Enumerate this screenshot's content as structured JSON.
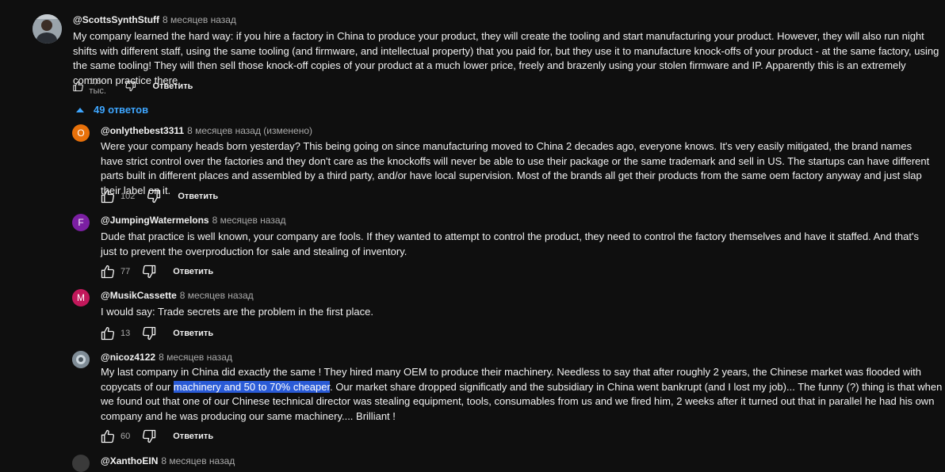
{
  "top_comment": {
    "author": "@ScottsSynthStuff",
    "time": "8 месяцев назад",
    "text": "My company learned the hard way: if you hire a factory in China to produce your product, they will create the tooling and start manufacturing your product. However, they will also run night shifts with different staff, using the same tooling (and firmware, and intellectual property) that you paid for, but they use it to manufacture knock-offs of your product - at the same factory, using the same tooling! They will then sell those knock-off copies of your product at a much lower price, freely and brazenly using your stolen firmware and IP. Apparently this is an extremely common practice there.",
    "likes": "1,6 тыс.",
    "reply_label": "Ответить"
  },
  "replies_toggle": {
    "label": "49 ответов"
  },
  "replies": [
    {
      "avatar_letter": "O",
      "avatar_color": "#e8710a",
      "author": "@onlythebest3311",
      "time": "8 месяцев назад (изменено)",
      "text": "Were your company heads born yesterday? This being going on since manufacturing moved to China 2 decades ago, everyone knows.  It's very easily mitigated, the brand names have strict control over the factories and they don't care as the knockoffs will never be able to use their package or the same trademark and sell in US. The startups can have different parts built in different places and assembled by a third party, and/or have local supervision. Most of the brands all get their products from the same oem factory anyway and just slap their label on it.",
      "likes": "102",
      "reply_label": "Ответить"
    },
    {
      "avatar_letter": "F",
      "avatar_color": "#7b1fa2",
      "author": "@JumpingWatermelons",
      "time": "8 месяцев назад",
      "text": "Dude that practice is well known, your company are fools. If they wanted to attempt to control the product, they need to control the factory themselves and have it staffed. And that's just to prevent the overproduction for sale and stealing of inventory.",
      "likes": "77",
      "reply_label": "Ответить"
    },
    {
      "avatar_letter": "M",
      "avatar_color": "#c2185b",
      "author": "@MusikCassette",
      "time": "8 месяцев назад",
      "text": "I would say: Trade secrets are the problem in the first place.",
      "likes": "13",
      "reply_label": "Ответить"
    },
    {
      "avatar_letter": "",
      "avatar_color": "#5f6a72",
      "author": "@nicoz4122",
      "time": "8 месяцев назад",
      "text_before": "My last company in China did exactly the same ! They hired many OEM to produce their machinery. Needless to say that after roughly 2 years, the Chinese market was flooded with copycats of our ",
      "text_highlight": "machinery and 50 to 70% cheaper",
      "text_after": ". Our market share dropped significatly and the subsidiary in China went bankrupt (and I lost my job)... The funny (?) thing is that when we found out that one of our Chinese technical director was stealing equipment, tools, consumables from us and we fired him, 2 weeks after it turned out that in parallel he had his own company and he was producing our same machinery.... Brilliant !",
      "likes": "60",
      "reply_label": "Ответить"
    },
    {
      "author": "@XanthoEIN",
      "time": "8 месяцев назад"
    }
  ],
  "icons": {
    "like": "thumbs-up-icon",
    "dislike": "thumbs-down-icon",
    "toggle": "chevron-up-icon"
  },
  "colors": {
    "background": "#0f0f0f",
    "link": "#3ea6ff",
    "highlight": "#2a5bd7"
  }
}
